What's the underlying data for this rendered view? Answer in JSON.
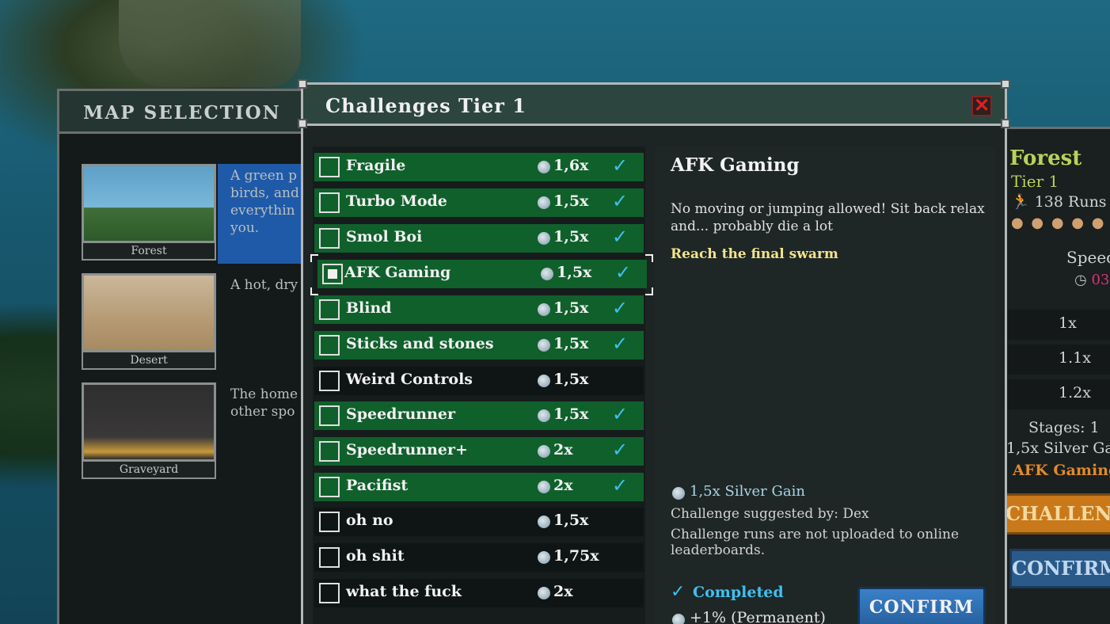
{
  "map_selection": {
    "title": "MAP SELECTION",
    "maps": [
      {
        "name": "Forest",
        "desc": "A green p\nbirds, and\neverythin\nyou."
      },
      {
        "name": "Desert",
        "desc": "A hot, dry"
      },
      {
        "name": "Graveyard",
        "desc": "The home\nother spo"
      }
    ]
  },
  "dialog": {
    "title": "Challenges Tier 1",
    "close_icon": "✕",
    "challenges": [
      {
        "name": "Fragile",
        "mult": "1,6x",
        "completed": true
      },
      {
        "name": "Turbo Mode",
        "mult": "1,5x",
        "completed": true
      },
      {
        "name": "Smol Boi",
        "mult": "1,5x",
        "completed": true
      },
      {
        "name": "AFK Gaming",
        "mult": "1,5x",
        "completed": true,
        "selected": true
      },
      {
        "name": "Blind",
        "mult": "1,5x",
        "completed": true
      },
      {
        "name": "Sticks and stones",
        "mult": "1,5x",
        "completed": true
      },
      {
        "name": "Weird Controls",
        "mult": "1,5x",
        "completed": false
      },
      {
        "name": "Speedrunner",
        "mult": "1,5x",
        "completed": true
      },
      {
        "name": "Speedrunner+",
        "mult": "2x",
        "completed": true
      },
      {
        "name": "Pacifist",
        "mult": "2x",
        "completed": true
      },
      {
        "name": "oh no",
        "mult": "1,5x",
        "completed": false
      },
      {
        "name": "oh shit",
        "mult": "1,75x",
        "completed": false
      },
      {
        "name": "what the fuck",
        "mult": "2x",
        "completed": false
      }
    ],
    "detail": {
      "title": "AFK Gaming",
      "description": "No moving or jumping allowed! Sit back relax and... probably die a lot",
      "goal": "Reach the final swarm",
      "gain": "1,5x Silver Gain",
      "suggested_by": "Challenge suggested by: Dex",
      "note": "Challenge runs are not uploaded to online leaderboards.",
      "completed_label": "Completed",
      "permanent_bonus": "+1% (Permanent)",
      "confirm_label": "CONFIRM"
    }
  },
  "run_panel": {
    "map_name": "Forest",
    "tier": "Tier 1",
    "runs": "138 Runs",
    "speed_label": "Speed",
    "time": "03",
    "multipliers": [
      "1x",
      "1.1x",
      "1.2x"
    ],
    "stages": "Stages: 1",
    "gain": "1,5x Silver Ga",
    "challenge_name": "AFK Gaming",
    "challenge_button": "CHALLENGE",
    "confirm_button": "CONFIRM"
  },
  "icons": {
    "coin": "silver-coin-icon",
    "check": "✓",
    "runner": "runner-icon",
    "clock": "clock-icon"
  },
  "colors": {
    "completed_row": "#10602c",
    "check": "#3ec0f0",
    "goal": "#f3e48a",
    "confirm": "#2f72b8",
    "close": "#e02020"
  }
}
